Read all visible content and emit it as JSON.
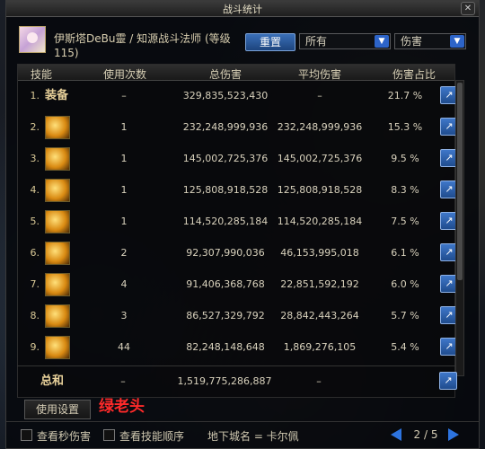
{
  "window": {
    "title": "战斗统计",
    "close": "✕"
  },
  "character": {
    "name": "伊斯塔DeBu靈 / 知源战斗法师 (等级115)"
  },
  "controls": {
    "reset_label": "重置",
    "filter_value": "所有",
    "type_value": "伤害",
    "arrow": "▼"
  },
  "table": {
    "headers": [
      "技能",
      "使用次数",
      "总伤害",
      "平均伤害",
      "伤害占比"
    ],
    "rows": [
      {
        "rank": "1.",
        "label": "装备",
        "uses": "–",
        "total": "329,835,523,430",
        "avg": "–",
        "pct": "21.7 %"
      },
      {
        "rank": "2.",
        "label": "",
        "uses": "1",
        "total": "232,248,999,936",
        "avg": "232,248,999,936",
        "pct": "15.3 %"
      },
      {
        "rank": "3.",
        "label": "",
        "uses": "1",
        "total": "145,002,725,376",
        "avg": "145,002,725,376",
        "pct": "9.5 %"
      },
      {
        "rank": "4.",
        "label": "",
        "uses": "1",
        "total": "125,808,918,528",
        "avg": "125,808,918,528",
        "pct": "8.3 %"
      },
      {
        "rank": "5.",
        "label": "",
        "uses": "1",
        "total": "114,520,285,184",
        "avg": "114,520,285,184",
        "pct": "7.5 %"
      },
      {
        "rank": "6.",
        "label": "",
        "uses": "2",
        "total": "92,307,990,036",
        "avg": "46,153,995,018",
        "pct": "6.1 %"
      },
      {
        "rank": "7.",
        "label": "",
        "uses": "4",
        "total": "91,406,368,768",
        "avg": "22,851,592,192",
        "pct": "6.0 %"
      },
      {
        "rank": "8.",
        "label": "",
        "uses": "3",
        "total": "86,527,329,792",
        "avg": "28,842,443,264",
        "pct": "5.7 %"
      },
      {
        "rank": "9.",
        "label": "",
        "uses": "44",
        "total": "82,248,148,648",
        "avg": "1,869,276,105",
        "pct": "5.4 %"
      }
    ],
    "total": {
      "label": "总和",
      "uses": "–",
      "total": "1,519,775,286,887",
      "avg": "–"
    },
    "share_icon": "↗"
  },
  "footer": {
    "settings_label": "使用设置",
    "watermark": "绿老头",
    "checkbox1_label": "查看秒伤害",
    "checkbox2_label": "查看技能顺序",
    "dungeon_label": "地下城名 = 卡尔佩",
    "page_text": "2 / 5"
  }
}
